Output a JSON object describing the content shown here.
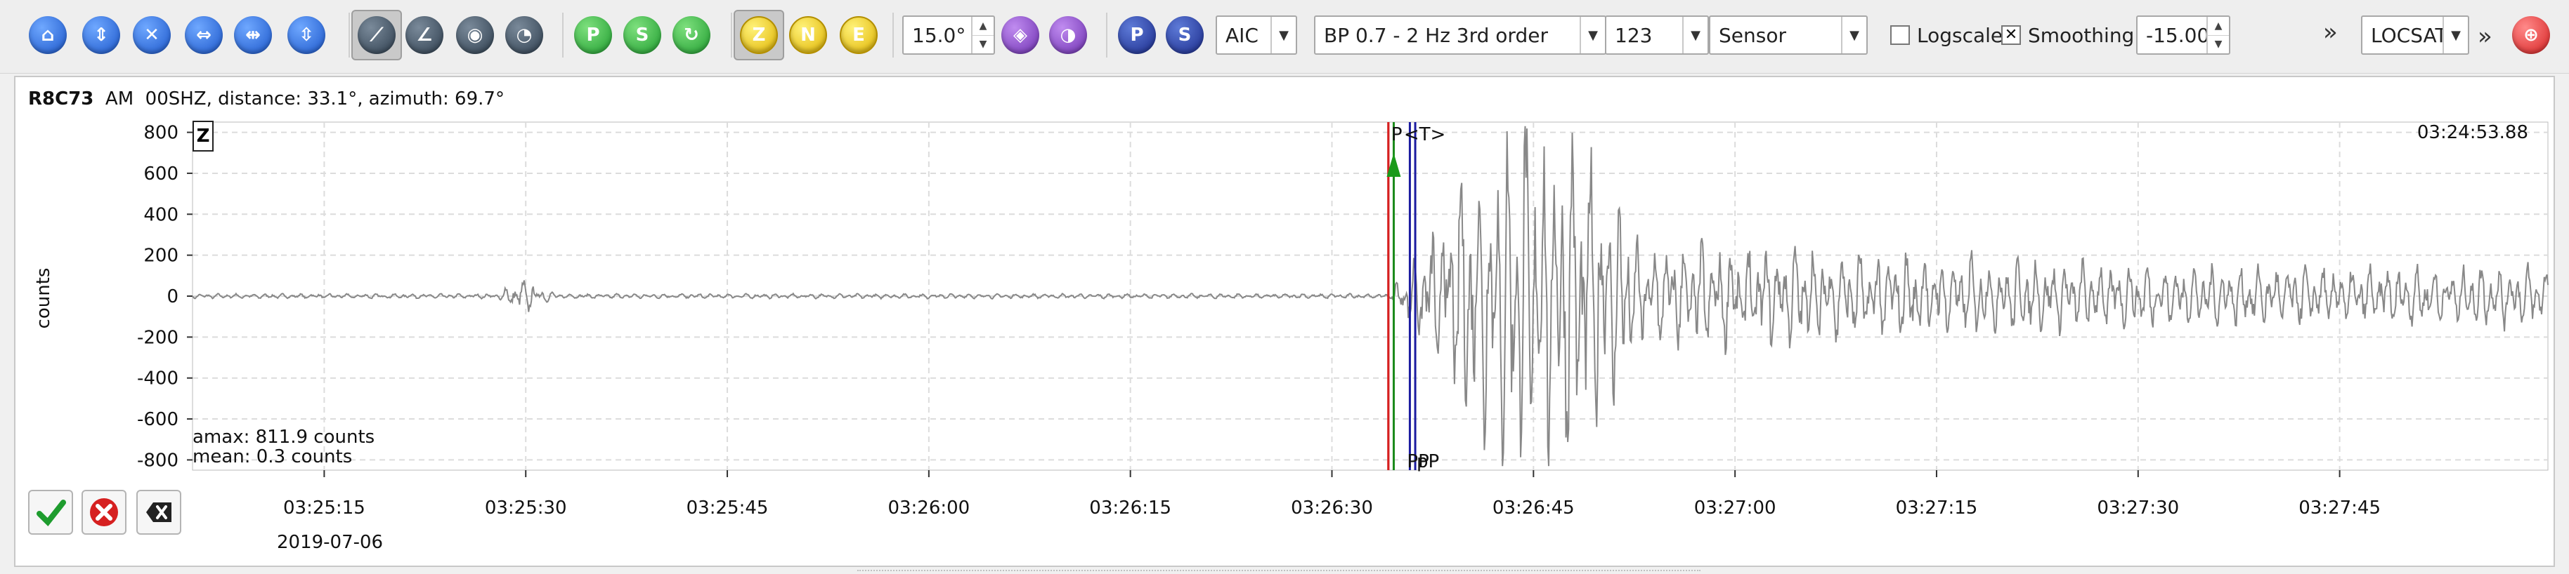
{
  "toolbar": {
    "nav_icons": [
      "home-icon",
      "zoom-fit-icon",
      "zoom-out-icon",
      "previous-icon",
      "next-icon",
      "align-icon"
    ],
    "pick_mode_icons": [
      "pick-mode-1-icon",
      "pick-mode-2-icon",
      "pick-mode-3-icon",
      "pick-mode-4-icon"
    ],
    "phase_icons": [
      "pick-p-icon",
      "pick-s-icon",
      "pick-other-icon"
    ],
    "components": [
      "Z",
      "N",
      "E"
    ],
    "rotation_angle": "15.0°",
    "picker": "AIC",
    "filter": "BP 0.7 - 2 Hz  3rd order",
    "channel_order": "123",
    "unit_mode": "Sensor",
    "logscale_label": "Logscale",
    "logscale_checked": false,
    "smoothing_label": "Smoothing",
    "smoothing_checked": true,
    "offset_value": "-15.00",
    "locator": "LOCSAT",
    "more_symbol": "»",
    "phase_buttons": [
      "P",
      "S"
    ]
  },
  "trace": {
    "station": "R8C73",
    "network": "AM",
    "channel": "00SHZ",
    "header_rest": "distance: 33.1°, azimuth: 69.7°",
    "component_label": "Z",
    "y_axis_label": "counts",
    "start_time": "03:24:53.88",
    "date": "2019-07-06",
    "amax": "amax: 811.9 counts",
    "mean": "mean: 0.3 counts",
    "pick_labels": [
      "P",
      "<T>",
      "PP",
      "pP"
    ]
  },
  "chart_data": {
    "type": "line",
    "ylabel": "counts",
    "ylim": [
      -850,
      850
    ],
    "y_ticks": [
      800,
      600,
      400,
      200,
      0,
      -200,
      -400,
      -600,
      -800
    ],
    "x_ticks": [
      "03:25:15",
      "03:25:30",
      "03:25:45",
      "03:26:00",
      "03:26:15",
      "03:26:30",
      "03:26:45",
      "03:27:00",
      "03:27:15",
      "03:27:30",
      "03:27:45"
    ],
    "x_tick_seconds": [
      15,
      30,
      45,
      60,
      75,
      90,
      105,
      120,
      135,
      150,
      165
    ],
    "xlim_seconds": [
      5.2,
      180.5
    ],
    "grid": true,
    "picks": [
      {
        "label": "P",
        "time_s": 94.2,
        "color": "#d62020"
      },
      {
        "label": "<T>",
        "time_s": 94.2,
        "color": "#d62020"
      },
      {
        "label": "P",
        "time_s": 94.6,
        "color": "#1a8a1a"
      },
      {
        "label": "PP",
        "time_s": 95.8,
        "color": "#1a1aa0"
      },
      {
        "label": "pP",
        "time_s": 96.2,
        "color": "#1a1aa0"
      }
    ],
    "line_color": "#888888"
  },
  "actions": [
    "accept-icon",
    "reject-icon",
    "clear-icon"
  ]
}
